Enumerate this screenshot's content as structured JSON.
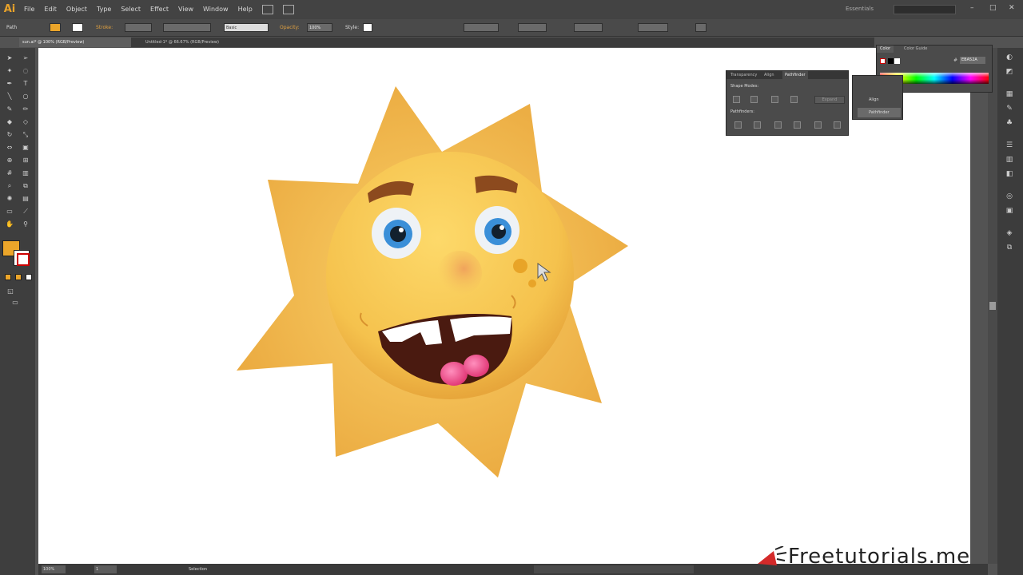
{
  "app": {
    "logo": "Ai",
    "menu": [
      "File",
      "Edit",
      "Object",
      "Type",
      "Select",
      "Effect",
      "View",
      "Window",
      "Help"
    ],
    "workspace": "Essentials",
    "window_controls": [
      "–",
      "□",
      "✕"
    ]
  },
  "control_bar": {
    "selection_label": "Path",
    "stroke_label": "Stroke:",
    "brush_label": "Basic",
    "opacity_label": "Opacity:",
    "opacity_value": "100%",
    "style_label": "Style:",
    "fill_color": "#eba52a"
  },
  "tabs": [
    {
      "label": "sun.ai* @ 100% (RGB/Preview)",
      "active": true
    },
    {
      "label": "Untitled-1* @ 66.67% (RGB/Preview)",
      "active": false
    }
  ],
  "pathfinder": {
    "tabs": [
      "Transparency",
      "Align",
      "Pathfinder"
    ],
    "active_tab": "Pathfinder",
    "shape_modes_label": "Shape Modes:",
    "pathfinders_label": "Pathfinders:",
    "expand_label": "Expand"
  },
  "flyout": {
    "items": [
      "Align",
      "Pathfinder"
    ],
    "selected": "Pathfinder"
  },
  "color_panel": {
    "tabs": [
      "Color",
      "Color Guide"
    ],
    "hex": "EBA52A"
  },
  "status_bar": {
    "zoom": "100%",
    "page": "1",
    "mode": "Selection"
  },
  "watermark": {
    "text": "Freetutorials.me"
  },
  "colors": {
    "fill": "#eba52a",
    "sun_yellow": "#f6c24a",
    "sun_shadow": "#e3a23a",
    "brow": "#8c4a1e",
    "mouth": "#4a1a10",
    "tongue": "#e84880",
    "eye_iris": "#3a8fd8"
  }
}
